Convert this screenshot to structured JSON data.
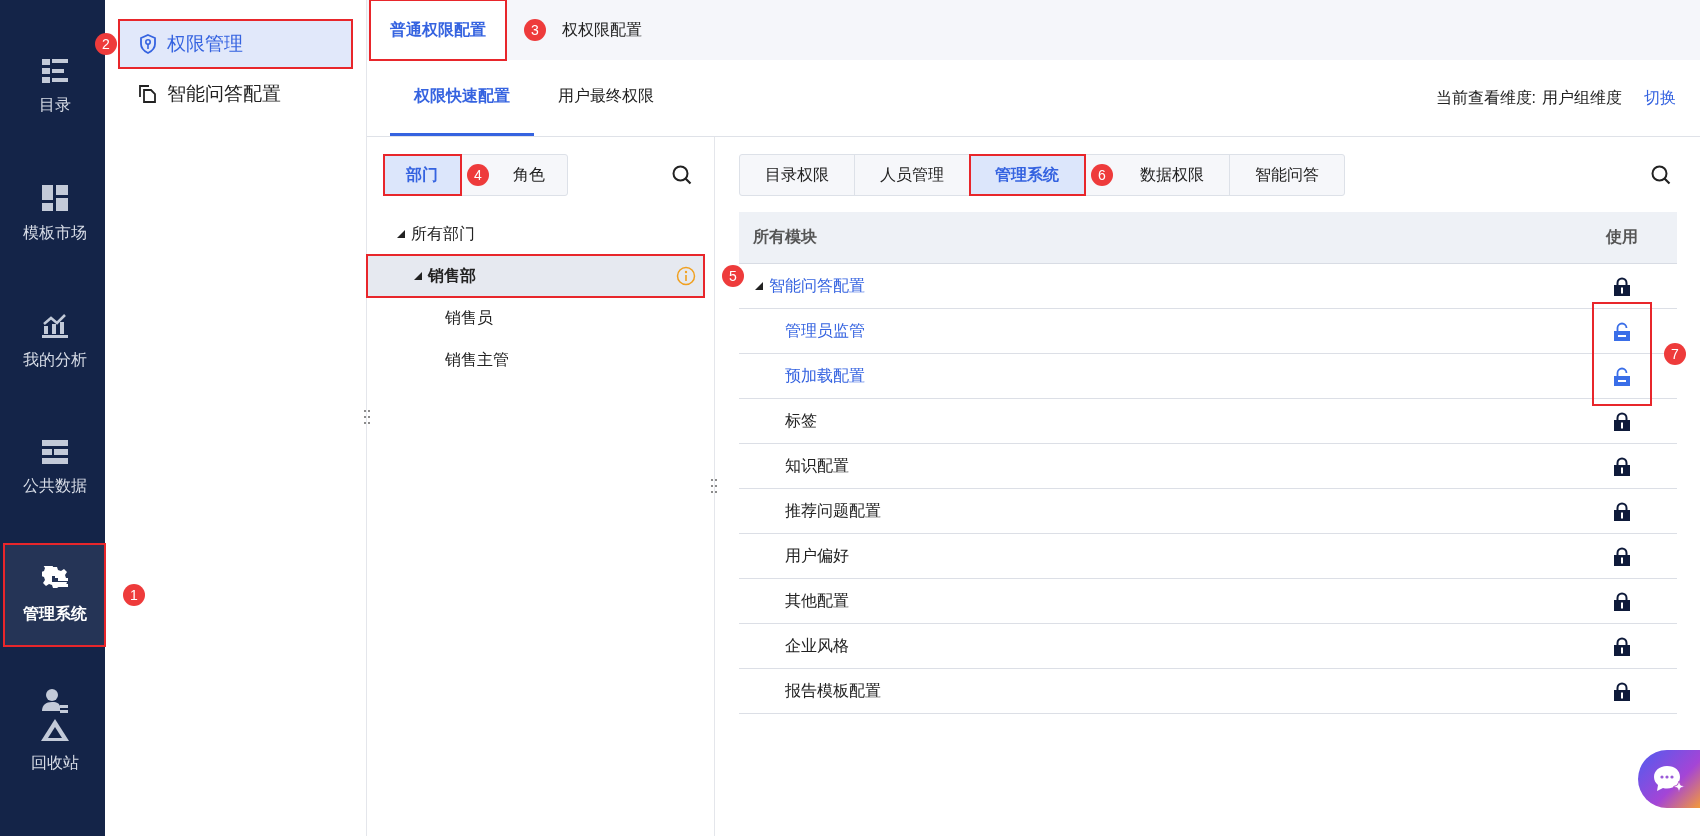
{
  "nav": [
    {
      "label": "目录",
      "selected": false
    },
    {
      "label": "模板市场",
      "selected": false
    },
    {
      "label": "我的分析",
      "selected": false
    },
    {
      "label": "公共数据",
      "selected": false
    },
    {
      "label": "管理系统",
      "selected": true,
      "callout": "1"
    },
    {
      "label": "回收站",
      "selected": false
    }
  ],
  "sidebar": {
    "items": [
      {
        "label": "权限管理",
        "selected": true,
        "callout": "2"
      },
      {
        "label": "智能问答配置",
        "selected": false
      }
    ]
  },
  "top_tabs": [
    {
      "label": "普通权限配置",
      "selected": true,
      "callout": "3"
    },
    {
      "label": "权权限配置",
      "selected": false
    }
  ],
  "sub_tabs": [
    {
      "label": "权限快速配置",
      "selected": true
    },
    {
      "label": "用户最终权限",
      "selected": false
    }
  ],
  "view_mode": {
    "label": "当前查看维度:",
    "value": "用户组维度",
    "action": "切换"
  },
  "dept_panel": {
    "tabs": [
      {
        "label": "部门",
        "selected": true,
        "callout": "4"
      },
      {
        "label": "角色",
        "selected": false
      }
    ],
    "nodes": [
      {
        "label": "所有部门",
        "expanded": true,
        "selected": false,
        "children": [
          {
            "label": "销售部",
            "expanded": true,
            "selected": true,
            "info": true,
            "callout": "5",
            "children": [
              {
                "label": "销售员",
                "selected": false
              },
              {
                "label": "销售主管",
                "selected": false
              }
            ]
          }
        ]
      }
    ]
  },
  "module_tabs": [
    {
      "label": "目录权限",
      "selected": false
    },
    {
      "label": "人员管理",
      "selected": false
    },
    {
      "label": "管理系统",
      "selected": true,
      "callout": "6"
    },
    {
      "label": "数据权限",
      "selected": false
    },
    {
      "label": "智能问答",
      "selected": false
    }
  ],
  "table": {
    "columns": [
      "所有模块",
      "使用"
    ],
    "callout": "7",
    "rows": [
      {
        "label": "智能问答配置",
        "active": true,
        "locked": true,
        "expanded": true,
        "children": [
          {
            "label": "管理员监管",
            "active": true,
            "locked": false,
            "highlighted": true
          },
          {
            "label": "预加载配置",
            "active": true,
            "locked": false,
            "highlighted": true
          }
        ]
      },
      {
        "label": "标签",
        "active": false,
        "locked": true
      },
      {
        "label": "知识配置",
        "active": false,
        "locked": true
      },
      {
        "label": "推荐问题配置",
        "active": false,
        "locked": true
      },
      {
        "label": "用户偏好",
        "active": false,
        "locked": true
      },
      {
        "label": "其他配置",
        "active": false,
        "locked": true
      },
      {
        "label": "企业风格",
        "active": false,
        "locked": true
      },
      {
        "label": "报告模板配置",
        "active": false,
        "locked": true
      }
    ]
  }
}
